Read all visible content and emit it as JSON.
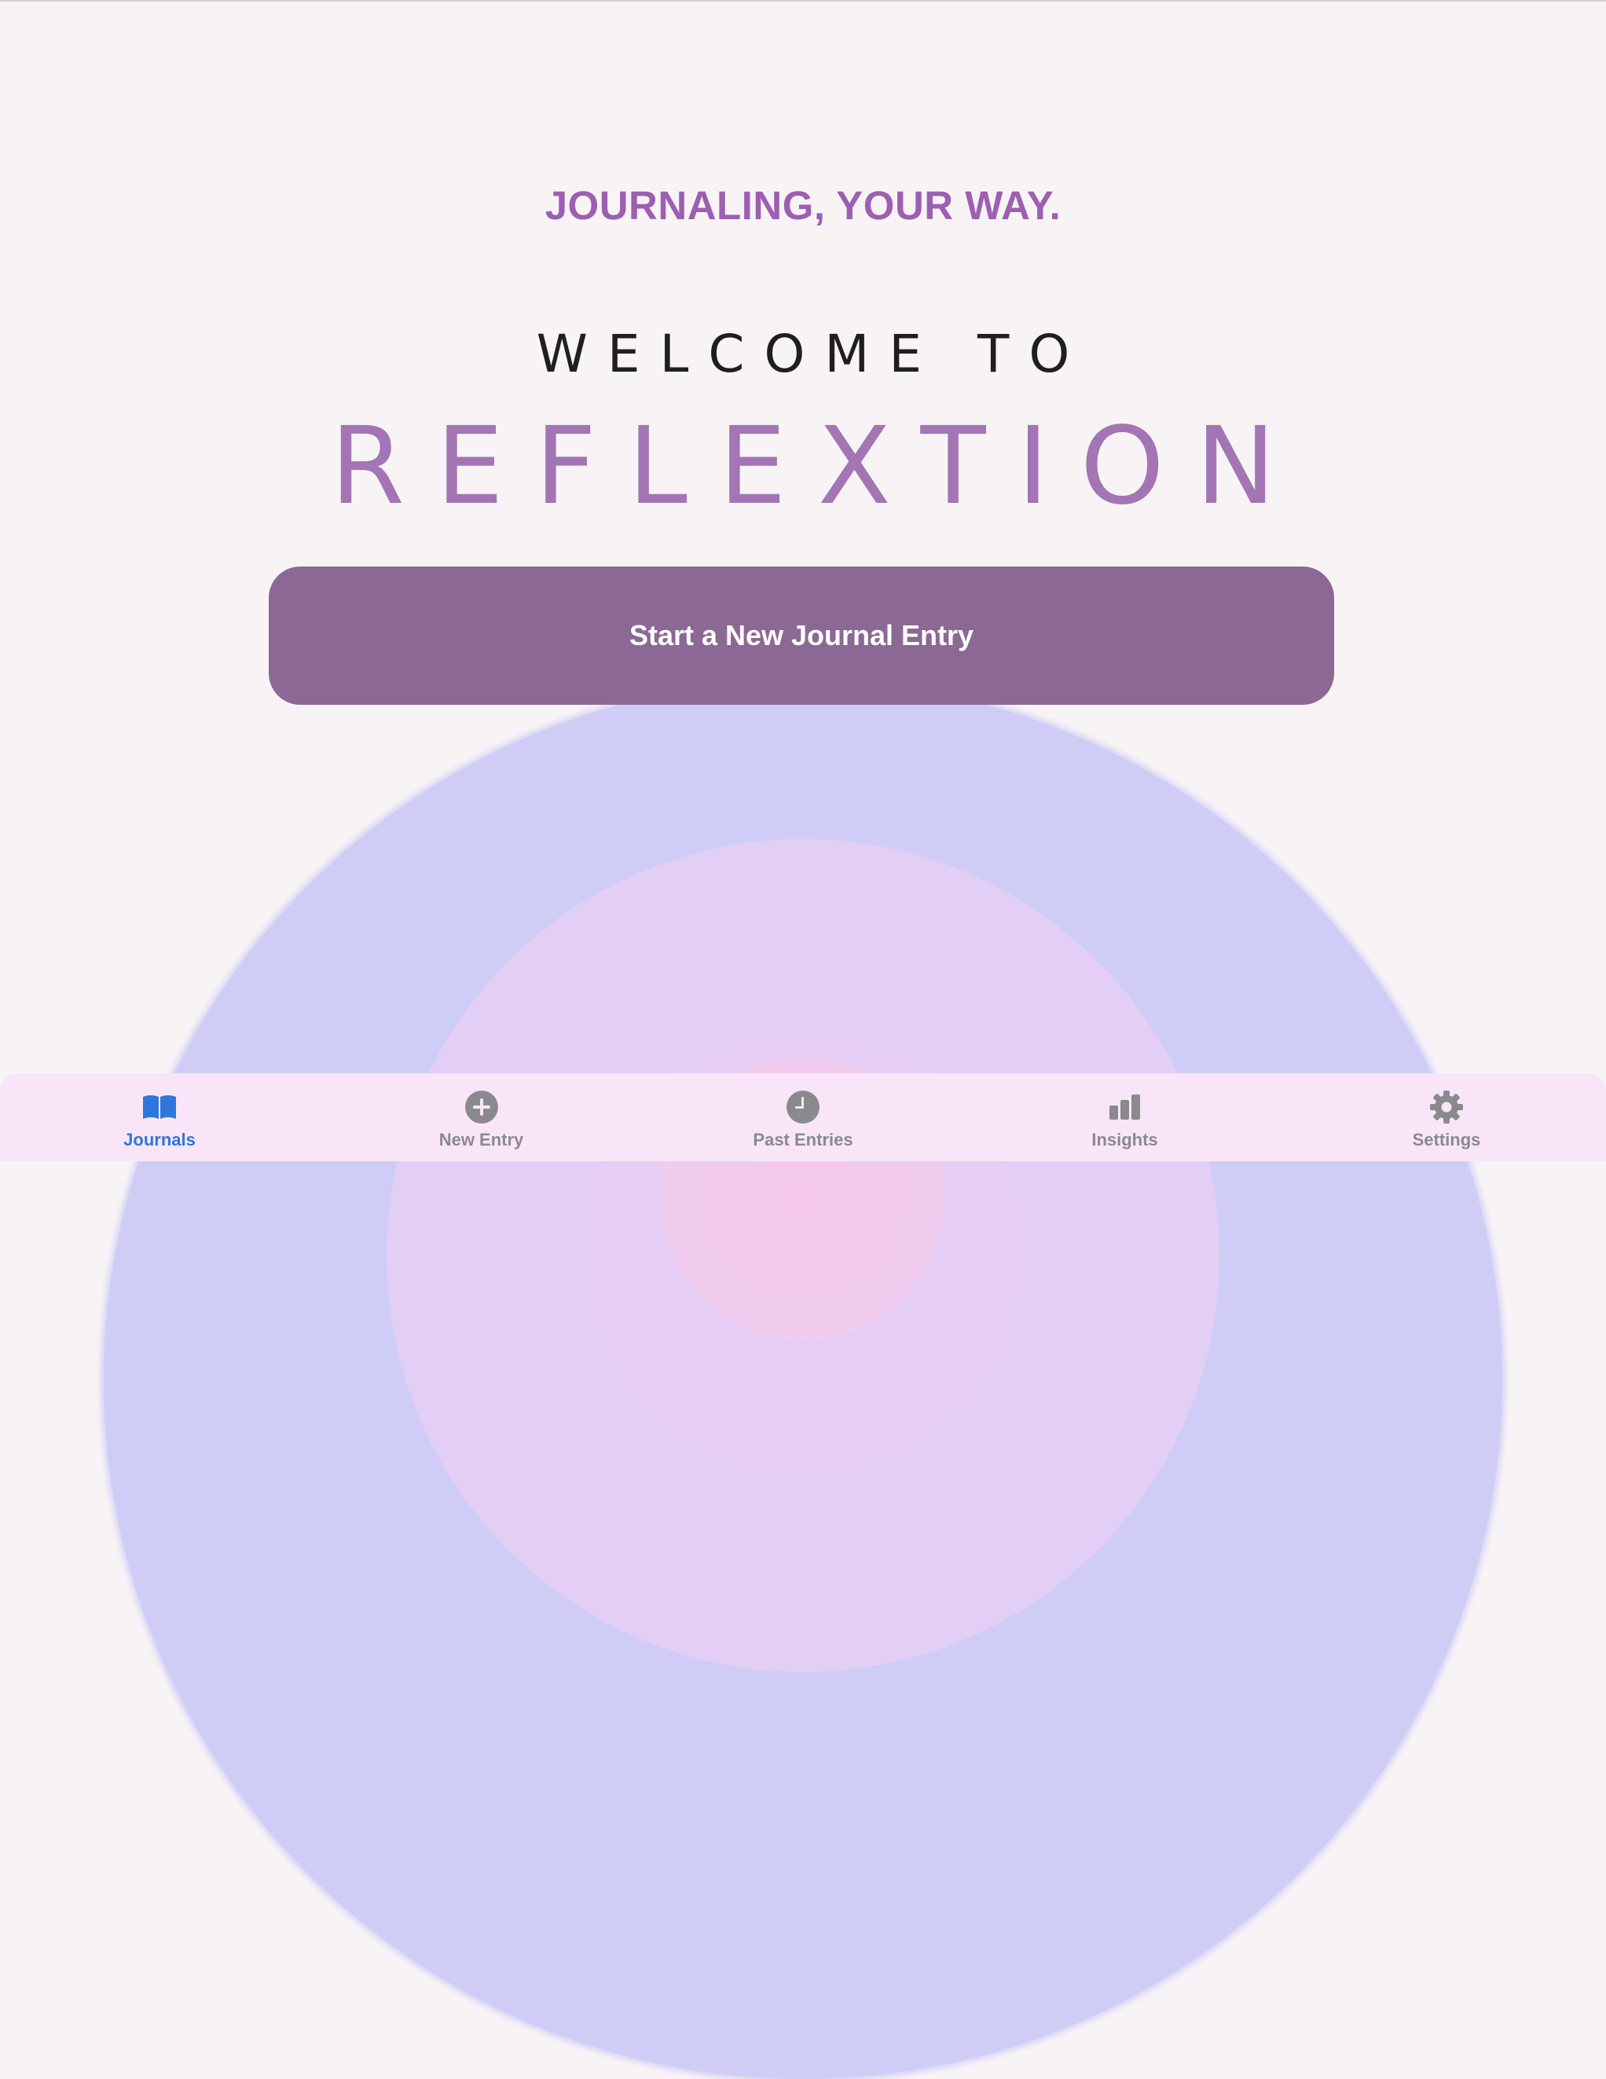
{
  "hero": {
    "tagline": "JOURNALING, YOUR WAY.",
    "welcome": "WELCOME TO",
    "brand": "REFLEXTION"
  },
  "cta": {
    "label": "Start a New Journal Entry"
  },
  "tabs": [
    {
      "label": "Journals",
      "icon": "book-open-icon",
      "active": true
    },
    {
      "label": "New Entry",
      "icon": "plus-circle-icon",
      "active": false
    },
    {
      "label": "Past Entries",
      "icon": "clock-icon",
      "active": false
    },
    {
      "label": "Insights",
      "icon": "bar-chart-icon",
      "active": false
    },
    {
      "label": "Settings",
      "icon": "gear-icon",
      "active": false
    }
  ],
  "colors": {
    "background": "#f8f4f6",
    "tagline": "#9c5fb1",
    "brand": "#a375b4",
    "button": "#8c6894",
    "tab_active": "#2f76db",
    "tab_inactive": "#8a8a8e",
    "tabbar": "#f8e6f8"
  }
}
